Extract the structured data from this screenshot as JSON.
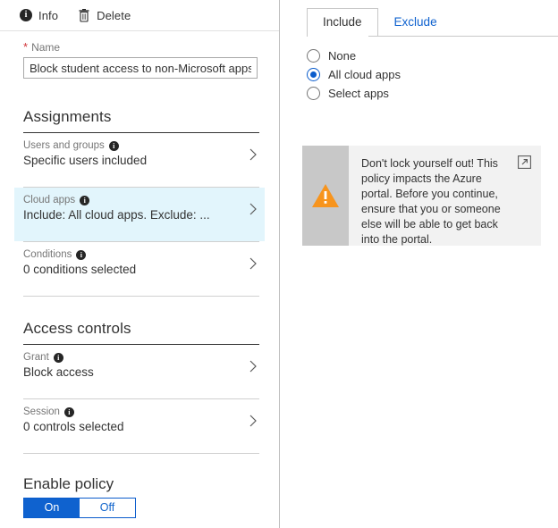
{
  "toolbar": {
    "info_label": "Info",
    "info_icon": "info-circle-icon",
    "delete_label": "Delete",
    "delete_icon": "trash-icon"
  },
  "name_field": {
    "required_marker": "*",
    "label": "Name",
    "value": "Block student access to non-Microsoft apps",
    "placeholder": "Name"
  },
  "assignments": {
    "title": "Assignments",
    "rows": [
      {
        "label": "Users and groups",
        "sub": "Specific users included",
        "info_icon": "info-circle-icon",
        "chevron_icon": "chevron-right-icon",
        "selected": false
      },
      {
        "label": "Cloud apps",
        "sub": "Include: All cloud apps. Exclude: ...",
        "info_icon": "info-circle-icon",
        "chevron_icon": "chevron-right-icon",
        "selected": true
      },
      {
        "label": "Conditions",
        "sub": "0 conditions selected",
        "info_icon": "info-circle-icon",
        "chevron_icon": "chevron-right-icon",
        "selected": false
      }
    ]
  },
  "access_controls": {
    "title": "Access controls",
    "rows": [
      {
        "label": "Grant",
        "sub": "Block access",
        "info_icon": "info-circle-icon",
        "chevron_icon": "chevron-right-icon",
        "selected": false
      },
      {
        "label": "Session",
        "sub": "0 controls selected",
        "info_icon": "info-circle-icon",
        "chevron_icon": "chevron-right-icon",
        "selected": false
      }
    ]
  },
  "enable_policy": {
    "title": "Enable policy",
    "on_label": "On",
    "off_label": "Off",
    "selected": "On"
  },
  "right_panel": {
    "tabs": [
      {
        "label": "Include",
        "active": true
      },
      {
        "label": "Exclude",
        "active": false
      }
    ],
    "radios": [
      {
        "label": "None",
        "checked": false
      },
      {
        "label": "All cloud apps",
        "checked": true
      },
      {
        "label": "Select apps",
        "checked": false
      }
    ],
    "warning": {
      "text": "Don't lock yourself out! This policy impacts the Azure portal. Before you continue, ensure that you or someone else will be able to get back into the portal.",
      "warning_icon": "warning-triangle-icon",
      "link_icon": "external-link-icon"
    }
  },
  "colors": {
    "accent_blue": "#0f62cf",
    "link_blue": "#1265cc",
    "selected_row_bg": "#e2f5fc",
    "warning_orange": "#f7941d",
    "warning_bar_gray": "#c8c8c8",
    "warning_box_bg": "#f2f2f2",
    "required_red": "#d13438"
  }
}
